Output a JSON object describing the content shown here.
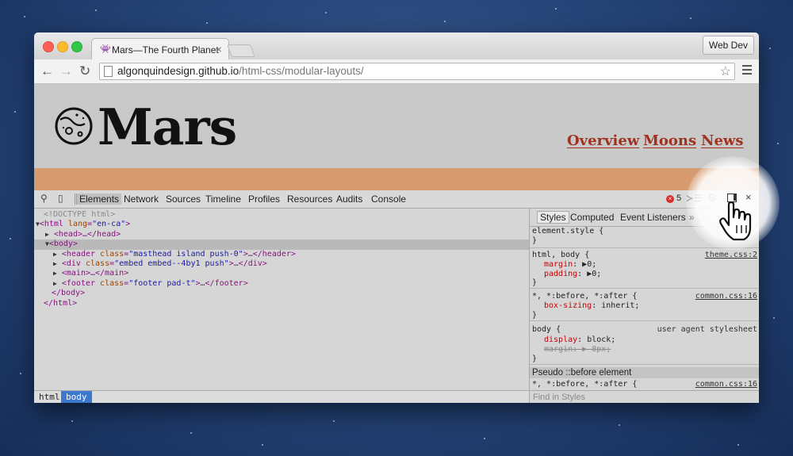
{
  "browser": {
    "tab_title": "Mars—The Fourth Planet",
    "tab_favicon": "alien-icon",
    "tab_close": "×",
    "profile_button": "Web Dev",
    "url_host": "algonquindesign.github.io",
    "url_path": "/html-css/modular-layouts/"
  },
  "page": {
    "brand": "Mars",
    "nav": [
      "Overview",
      "Moons",
      "News"
    ],
    "accent_color": "#a0331f",
    "band_color": "#d69c70"
  },
  "devtools": {
    "tabs": [
      "Elements",
      "Network",
      "Sources",
      "Timeline",
      "Profiles",
      "Resources",
      "Audits",
      "Console"
    ],
    "active_tab": "Elements",
    "error_count": "5",
    "dom": [
      {
        "doctype": "<!DOCTYPE html>"
      },
      {
        "open": "<html",
        "attrs": [
          [
            "lang",
            "en-ca"
          ]
        ],
        "close": ">"
      },
      {
        "collapsed": "<head>…</head>"
      },
      {
        "selected": "<body>"
      },
      {
        "tag": "<header",
        "attrs": [
          [
            "class",
            "masthead island push-0"
          ]
        ],
        "tail": ">…</header>"
      },
      {
        "tag": "<div",
        "attrs": [
          [
            "class",
            "embed embed--4by1 push"
          ]
        ],
        "tail": ">…</div>"
      },
      {
        "collapsed": "<main>…</main>"
      },
      {
        "tag": "<footer",
        "attrs": [
          [
            "class",
            "footer pad-t"
          ]
        ],
        "tail": ">…</footer>"
      },
      {
        "closing": "</body>"
      },
      {
        "closing": "</html>"
      }
    ],
    "breadcrumbs": [
      "html",
      "body"
    ],
    "styles_tabs": [
      "Styles",
      "Computed",
      "Event Listeners",
      "»"
    ],
    "rules": {
      "element_style": {
        "selector": "element.style {",
        "close": "}"
      },
      "html_body": {
        "selector": "html, body {",
        "source": "theme.css:2",
        "props": [
          [
            "margin",
            "▶0;"
          ],
          [
            "padding",
            "▶0;"
          ]
        ],
        "close": "}"
      },
      "universal": {
        "selector": "*, *:before, *:after {",
        "source": "common.css:16",
        "props": [
          [
            "box-sizing",
            "inherit;"
          ]
        ],
        "close": "}"
      },
      "body_ua": {
        "selector": "body {",
        "source": "user agent stylesheet",
        "props": [
          [
            "display",
            "block;"
          ],
          [
            "margin",
            "▶ 8px;"
          ]
        ],
        "close": "}"
      },
      "pseudo_heading": "Pseudo ::before element",
      "pseudo_rule": {
        "selector": "*, *:before, *:after {",
        "source": "common.css:16"
      }
    },
    "find_placeholder": "Find in Styles"
  }
}
